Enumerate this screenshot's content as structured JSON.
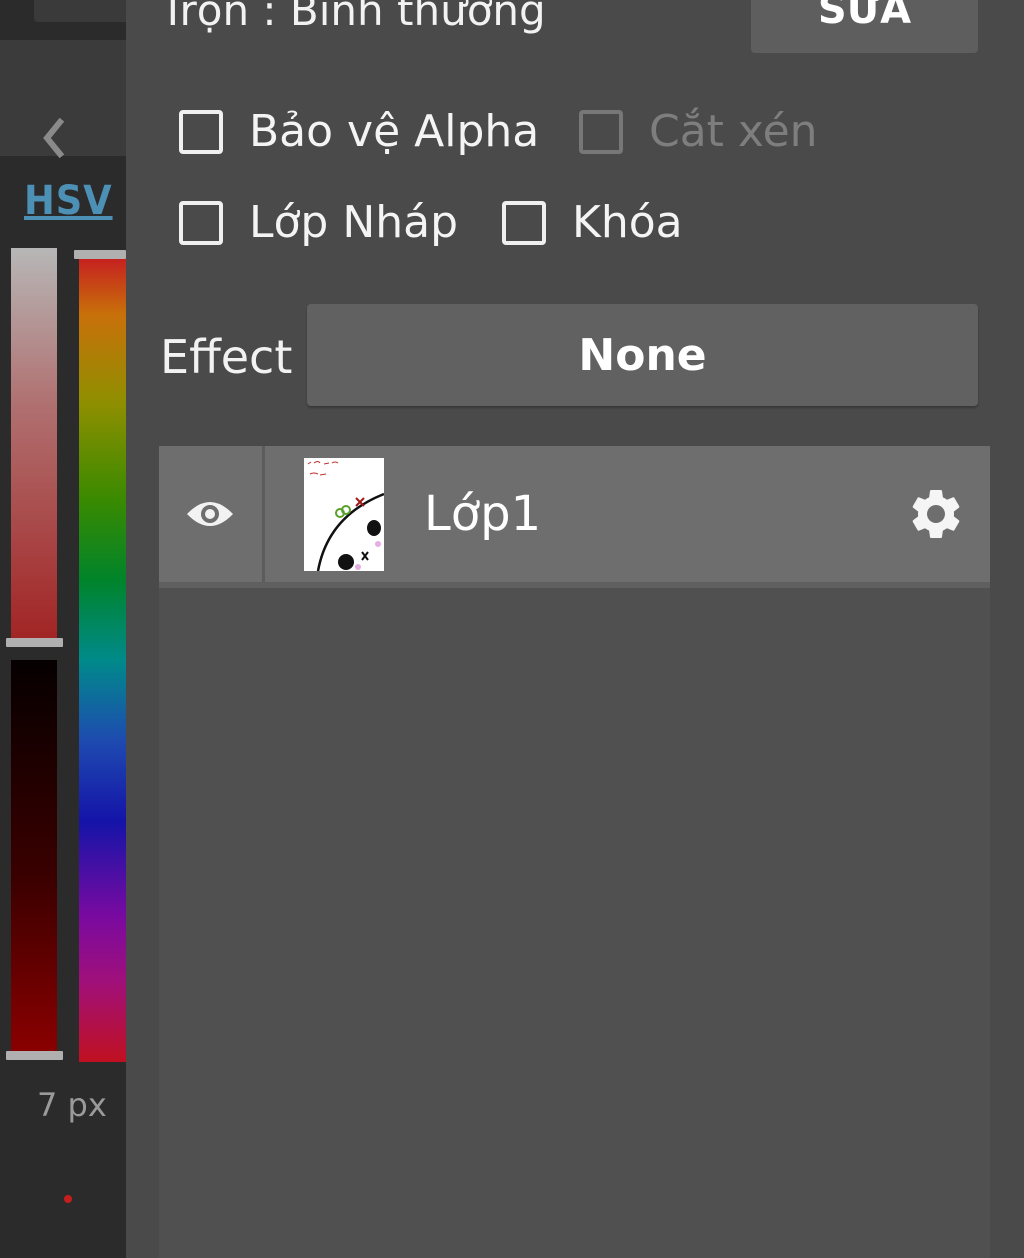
{
  "color_panel": {
    "mode_label": "HSV",
    "brush_size": "7 px",
    "accent_color": "#4d90b5"
  },
  "layer_panel": {
    "blend_mode_text": "Trộn : Bình thường",
    "edit_button_label": "SỬA",
    "checkboxes": {
      "protect_alpha": {
        "label": "Bảo vệ Alpha",
        "checked": false
      },
      "clipping": {
        "label": "Cắt xén",
        "checked": false,
        "disabled": true
      },
      "draft_layer": {
        "label": "Lớp Nháp",
        "checked": false
      },
      "lock": {
        "label": "Khóa",
        "checked": false
      }
    },
    "effect": {
      "label": "Effect",
      "value": "None"
    },
    "layers": [
      {
        "name": "Lớp1",
        "visible": true
      }
    ]
  }
}
